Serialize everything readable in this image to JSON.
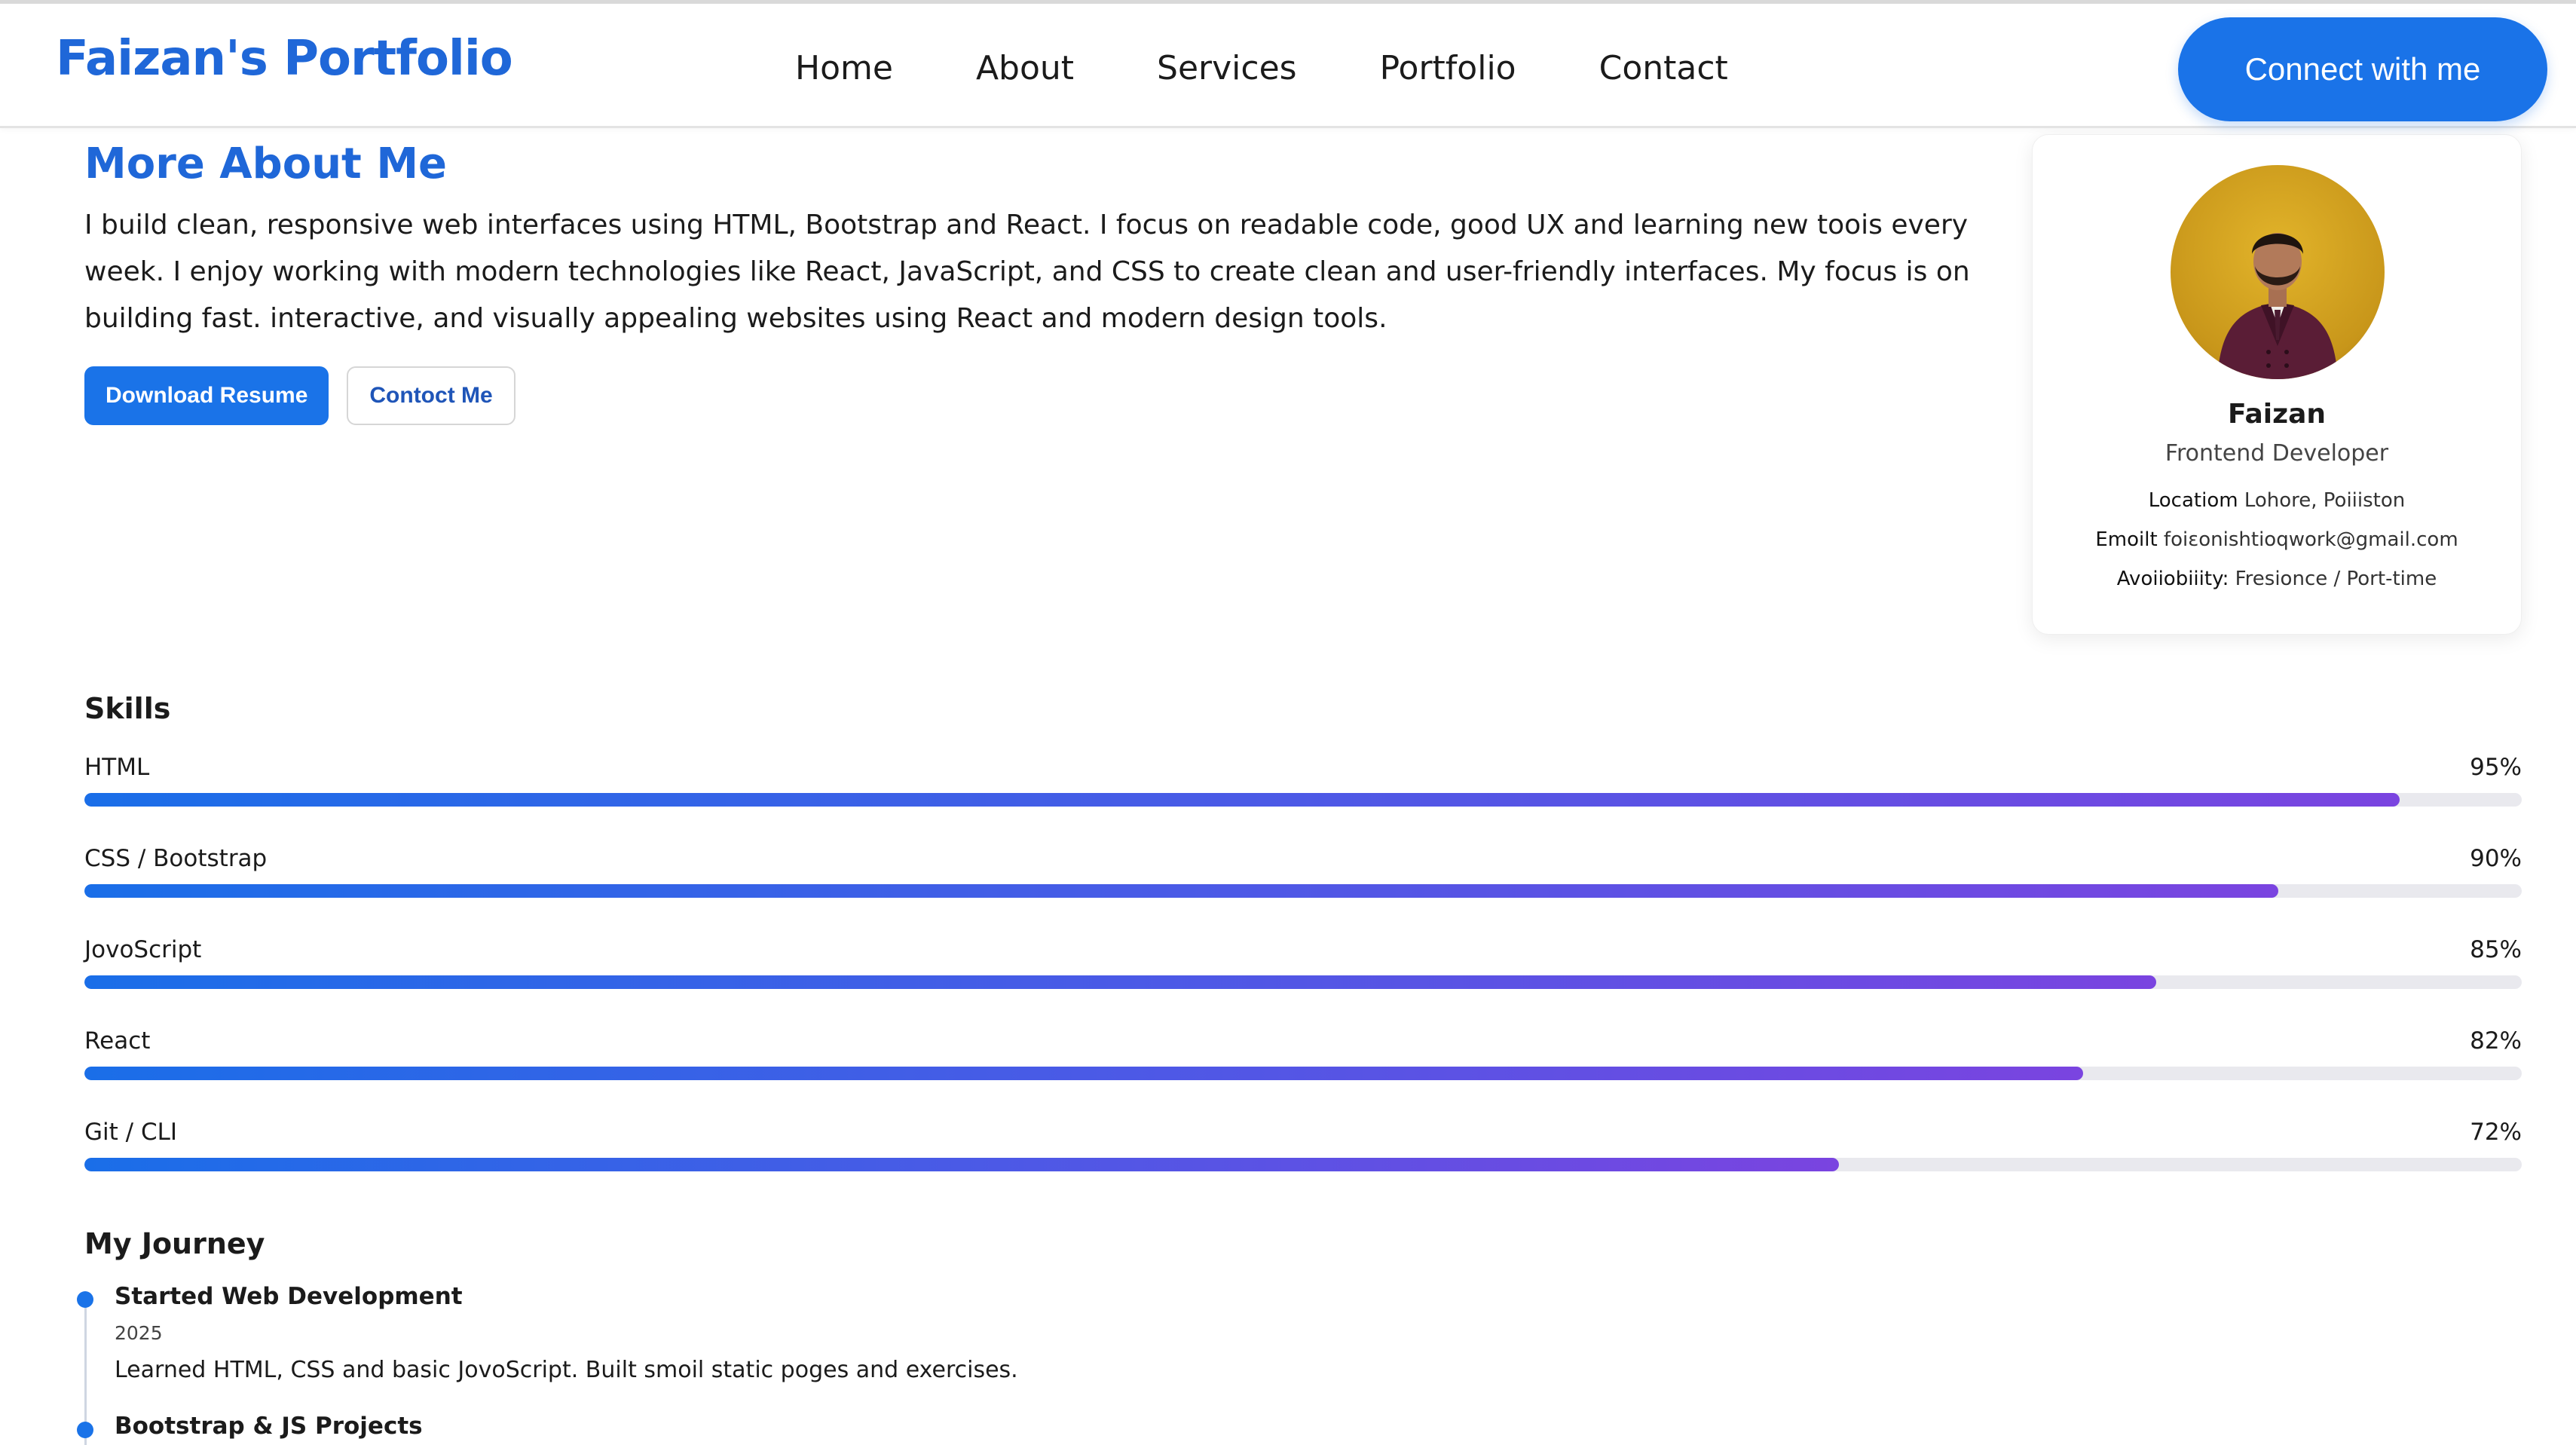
{
  "navbar": {
    "brand": "Faizan's Portfolio",
    "links": [
      "Home",
      "About",
      "Services",
      "Portfolio",
      "Contact"
    ],
    "cta": "Connect with me"
  },
  "about": {
    "title": "More About Me",
    "text": "I build clean, responsive web interfaces using HTML, Bootstrap and React. I focus on readable code, good UX and learning new toois every week. I enjoy working with modern technologies like React, JavaScript, and CSS to create clean and user-friendly interfaces. My focus is on building fast. interactive, and visually appealing websites using React and modern design tools.",
    "download_label": "Download Resume",
    "contact_label": "Contoct Me"
  },
  "profile": {
    "name": "Faizan",
    "role": "Frontend Developer",
    "location_label": "Locatiom",
    "location": "Lohore, Poiiiston",
    "email_label": "Emoilt",
    "email": "foiɛonishtioqwork@gmail.com",
    "availability_label": "Avoiiobiiity:",
    "availability": "Fresionce / Port-time",
    "accent": "#1a73e8"
  },
  "skills": {
    "heading": "Skills",
    "items": [
      {
        "name": "HTML",
        "percent_label": "95%",
        "level": 95
      },
      {
        "name": "CSS / Bootstrap",
        "percent_label": "90%",
        "level": 90
      },
      {
        "name": "JovoScript",
        "percent_label": "85%",
        "level": 85
      },
      {
        "name": "React",
        "percent_label": "82%",
        "level": 82
      },
      {
        "name": "Git / CLI",
        "percent_label": "72%",
        "level": 72
      }
    ]
  },
  "journey": {
    "heading": "My Journey",
    "items": [
      {
        "title": "Started Web Development",
        "year": "2025",
        "desc": "Learned HTML, CSS and basic JovoScript. Built smoil static poges and exercises."
      },
      {
        "title": "Bootstrap & JS Projects"
      }
    ]
  }
}
